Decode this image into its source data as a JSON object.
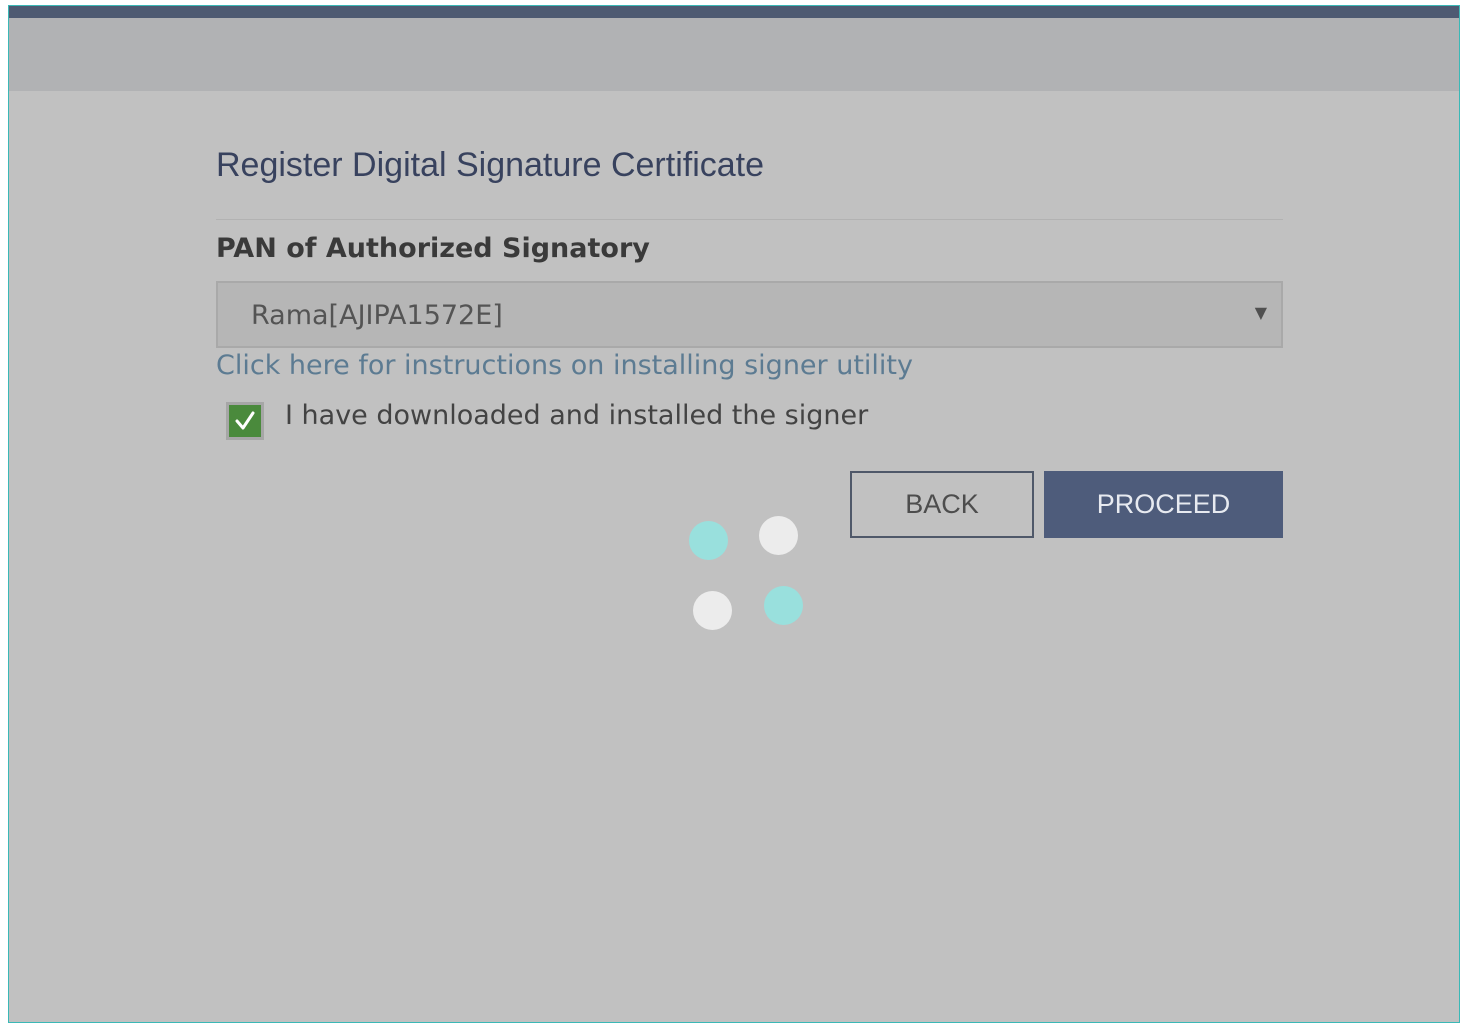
{
  "form": {
    "title": "Register Digital Signature Certificate",
    "pan_label": "PAN of Authorized Signatory",
    "pan_selected": "Rama[AJIPA1572E]",
    "instructions_link": "Click here for instructions on installing signer utility",
    "signer_checkbox_label": "I have downloaded and installed the signer",
    "signer_checkbox_checked": true
  },
  "buttons": {
    "back_label": "BACK",
    "proceed_label": "PROCEED"
  },
  "loader": {
    "icon": "loading-spinner-icon",
    "dot_colors": [
      "#99e0dd",
      "#ececec",
      "#ececec",
      "#99e0dd"
    ]
  },
  "colors": {
    "accent": "#4e5c7b",
    "link": "#5c7b92",
    "checkbox_fill": "#4a8a3c",
    "frame_border": "#3bb8b6"
  }
}
